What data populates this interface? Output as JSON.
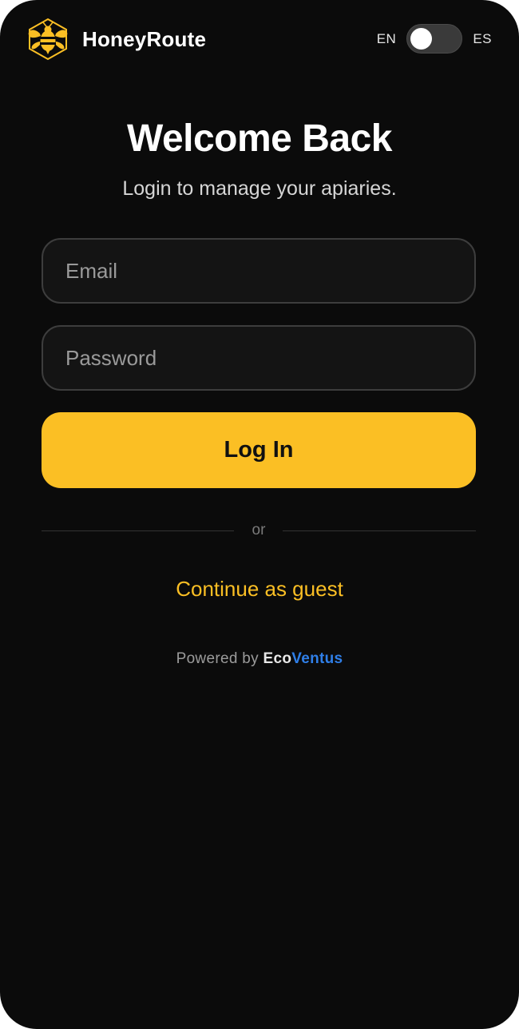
{
  "app": {
    "brand_name": "HoneyRoute",
    "logo_icon": "bee-hexagon-icon"
  },
  "language": {
    "left_label": "EN",
    "right_label": "ES",
    "selected": "EN"
  },
  "login": {
    "title": "Welcome Back",
    "subtitle": "Login to manage your apiaries.",
    "email_placeholder": "Email",
    "email_value": "",
    "password_placeholder": "Password",
    "password_value": "",
    "submit_label": "Log In",
    "divider_text": "or",
    "guest_label": "Continue as guest"
  },
  "footer": {
    "powered_prefix": "Powered by",
    "brand_part1": "Eco",
    "brand_part2": "Ventus"
  },
  "colors": {
    "background": "#0b0b0b",
    "accent": "#fbbf24",
    "eco_brand_blue": "#2f7fe8",
    "field_background": "#141414",
    "field_border": "#3d3d3d"
  }
}
